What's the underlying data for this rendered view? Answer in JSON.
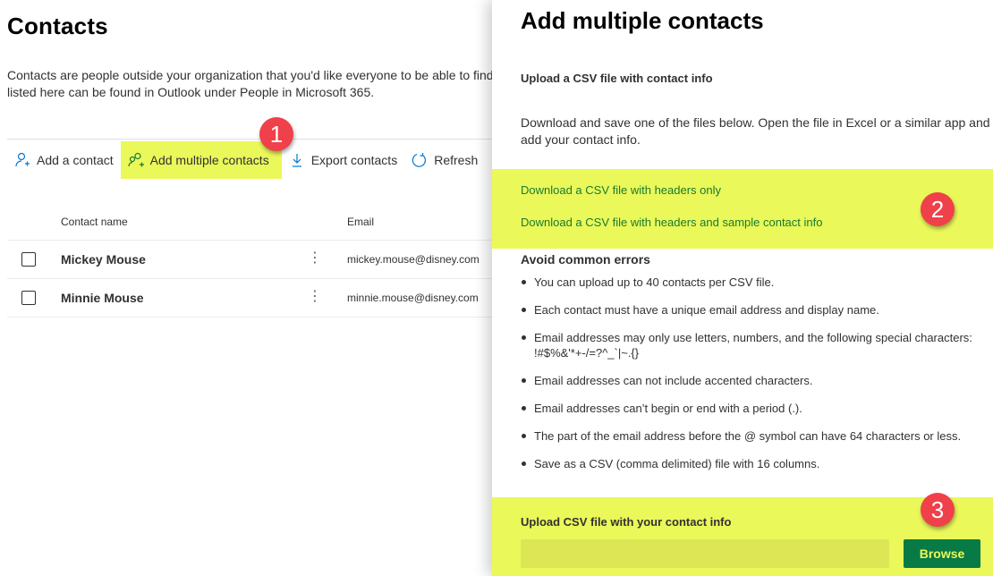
{
  "page": {
    "title": "Contacts",
    "description_line1": "Contacts are people outside your organization that you'd like everyone to be able to find.",
    "description_line2": "listed here can be found in Outlook under People in Microsoft 365."
  },
  "toolbar": {
    "items": [
      {
        "label": "Add a contact",
        "icon": "add-person-icon"
      },
      {
        "label": "Add multiple contacts",
        "icon": "add-people-icon",
        "highlighted": true
      },
      {
        "label": "Export contacts",
        "icon": "download-icon"
      },
      {
        "label": "Refresh",
        "icon": "refresh-icon"
      }
    ]
  },
  "table": {
    "columns": [
      "Contact name",
      "Email"
    ],
    "rows": [
      {
        "name": "Mickey Mouse",
        "email": "mickey.mouse@disney.com",
        "more": "⋮"
      },
      {
        "name": "Minnie Mouse",
        "email": "minnie.mouse@disney.com",
        "more": "⋮"
      }
    ]
  },
  "badges": [
    "1",
    "2",
    "3"
  ],
  "panel": {
    "title": "Add multiple contacts",
    "subtitle": "Upload a CSV file with contact info",
    "description": "Download and save one of the files below. Open the file in Excel or a similar app and add your contact info.",
    "downloads": [
      "Download a CSV file with headers only",
      "Download a CSV file with headers and sample contact info"
    ],
    "errors_heading": "Avoid common errors",
    "errors": [
      "You can upload up to 40 contacts per CSV file.",
      "Each contact must have a unique email address and display name.",
      "Email addresses may only use letters, numbers, and the following special characters: !#$%&'*+-/=?^_`|~.{}",
      "Email addresses can not include accented characters.",
      "Email addresses can’t begin or end with a period (.).",
      "The part of the email address before the @ symbol can have 64 characters or less.",
      "Save as a CSV (comma delimited) file with 16 columns."
    ],
    "upload_label": "Upload CSV file with your contact info",
    "upload_value": "",
    "browse_label": "Browse"
  },
  "colors": {
    "highlight": "#eaf85a",
    "link_green": "#1a7a2e",
    "button_green": "#087a45",
    "badge_red": "#f0404a",
    "accent_blue": "#0078d4"
  }
}
